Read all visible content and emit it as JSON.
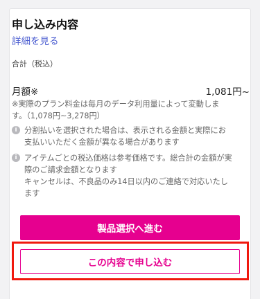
{
  "summary": {
    "title": "申し込み内容",
    "details_link": "詳細を見る",
    "total_label": "合計（税込）",
    "monthly_label": "月額※",
    "monthly_price": "1,081円~",
    "note": "※実際のプラン料金は毎月のデータ利用量によって変動します。（1,078円~3,278円）",
    "info_items": [
      {
        "icon": "info-icon",
        "text": "分割払いを選択された場合は、表示される金額と実際にお支払いいただく金額が異なる場合があります"
      },
      {
        "icon": "info-icon",
        "text_line1": "アイテムごとの税込価格は参考価格です。総合計の金額が実際のご請求金額となります",
        "text_line2": "キャンセルは、不良品のみ14日以内のご連絡で対応いたします"
      }
    ]
  },
  "actions": {
    "primary_label": "製品選択へ進む",
    "secondary_label": "この内容で申し込む"
  },
  "colors": {
    "accent": "#e6008f",
    "link": "#4d5fd1",
    "highlight": "#f0180d"
  }
}
